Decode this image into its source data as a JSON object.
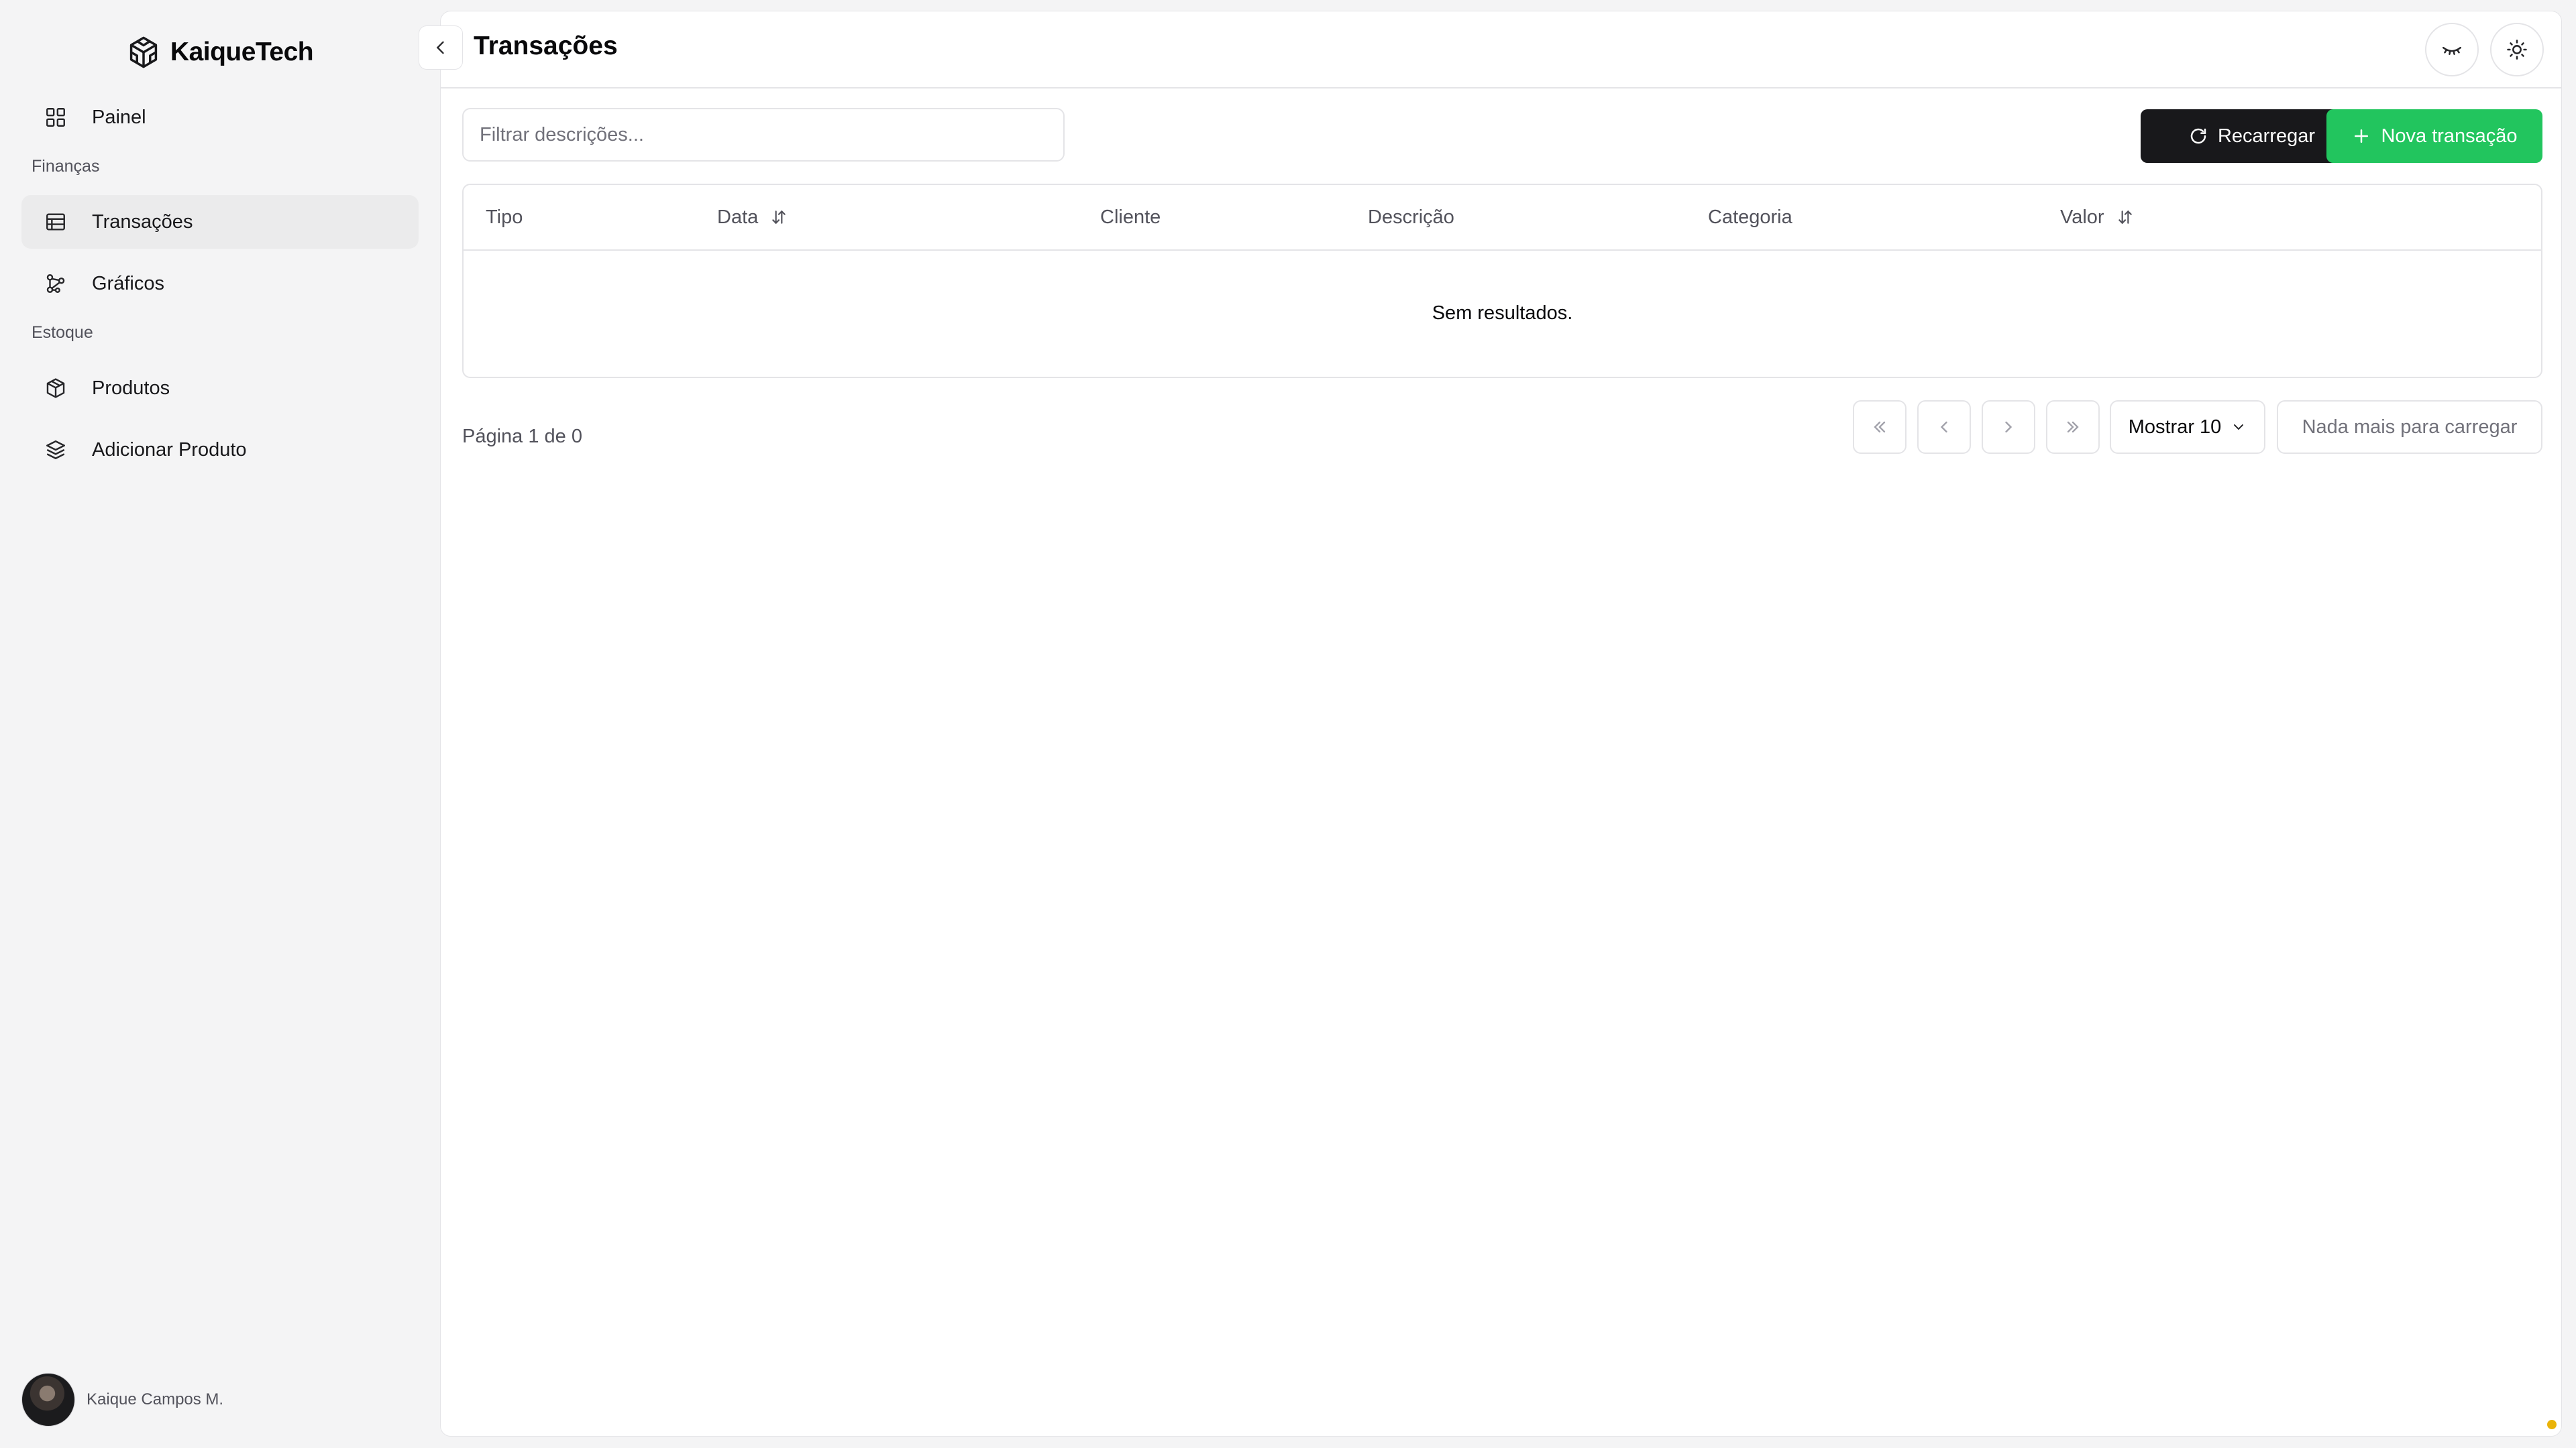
{
  "app": {
    "name": "KaiqueTech",
    "logo_icon": "codesandbox-icon"
  },
  "sidebar": {
    "groups": [
      {
        "label": "Finanças"
      },
      {
        "label": "Estoque"
      }
    ],
    "items": [
      {
        "label": "Painel",
        "icon": "grid-icon",
        "active": false
      },
      {
        "label": "Transações",
        "icon": "table-icon",
        "active": true
      },
      {
        "label": "Gráficos",
        "icon": "network-icon",
        "active": false
      },
      {
        "label": "Produtos",
        "icon": "box-icon",
        "active": false
      },
      {
        "label": "Adicionar Produto",
        "icon": "layers-icon",
        "active": false
      }
    ],
    "user": {
      "name": "Kaique Campos M."
    }
  },
  "header": {
    "title": "Transações"
  },
  "toolbar": {
    "filter_placeholder": "Filtrar descrições...",
    "filter_value": "",
    "reload_label": "Recarregar",
    "new_label": "Nova transação"
  },
  "table": {
    "columns": [
      {
        "label": "Tipo",
        "sortable": false
      },
      {
        "label": "Data",
        "sortable": true
      },
      {
        "label": "Cliente",
        "sortable": false
      },
      {
        "label": "Descrição",
        "sortable": false
      },
      {
        "label": "Categoria",
        "sortable": false
      },
      {
        "label": "Valor",
        "sortable": true
      }
    ],
    "rows": [],
    "empty_text": "Sem resultados."
  },
  "pagination": {
    "info": "Página 1 de 0",
    "page_size_label": "Mostrar 10",
    "load_more_label": "Nada mais para carregar"
  },
  "colors": {
    "accent": "#22c55e",
    "primary_dark": "#18181b",
    "indicator": "#eab308"
  }
}
